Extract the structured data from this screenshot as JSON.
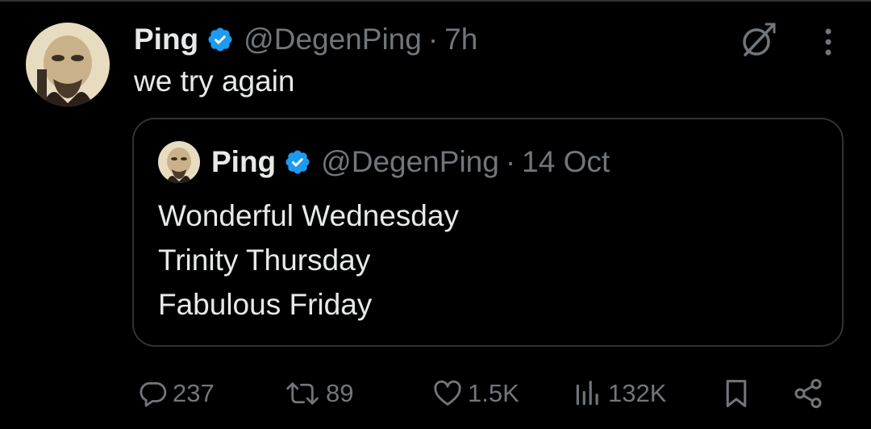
{
  "tweet": {
    "author_name": "Ping",
    "handle": "@DegenPing",
    "separator": "·",
    "time": "7h",
    "text": "we try again"
  },
  "quoted": {
    "author_name": "Ping",
    "handle": "@DegenPing",
    "separator": "·",
    "time": "14 Oct",
    "lines": [
      "Wonderful Wednesday",
      "Trinity Thursday",
      "Fabulous Friday"
    ]
  },
  "actions": {
    "replies": "237",
    "retweets": "89",
    "likes": "1.5K",
    "views": "132K"
  },
  "icons": {
    "verified": "verified-badge-icon",
    "grok": "grok-icon",
    "more": "more-vertical-icon",
    "reply": "reply-icon",
    "retweet": "retweet-icon",
    "like": "heart-icon",
    "views": "analytics-icon",
    "bookmark": "bookmark-icon",
    "share": "share-icon"
  },
  "colors": {
    "background": "#000000",
    "text": "#e7e9ea",
    "muted": "#71767b",
    "verified": "#1d9bf0",
    "border": "#2f3336"
  }
}
